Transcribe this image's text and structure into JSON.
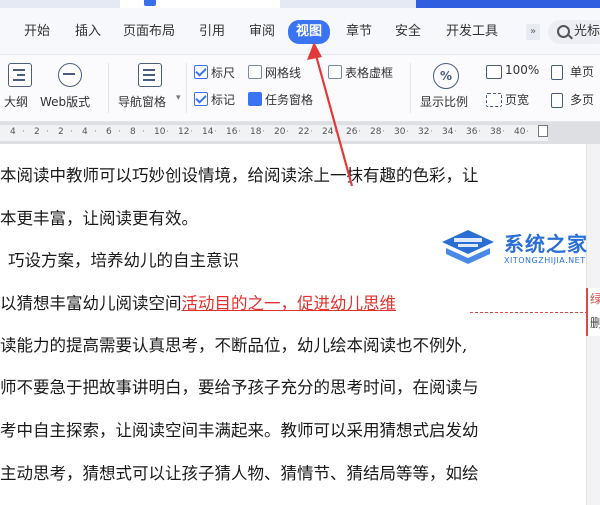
{
  "menu": {
    "tabs": [
      "开始",
      "插入",
      "页面布局",
      "引用",
      "审阅",
      "视图",
      "章节",
      "安全",
      "开发工具"
    ],
    "active_tab": "视图",
    "more": "»",
    "search_text": "光标"
  },
  "ribbon": {
    "outline_label": "大纲",
    "web_layout_label": "Web版式",
    "nav_pane_label": "导航窗格",
    "nav_pane_arrow": "▾",
    "checkboxes": {
      "ruler": {
        "label": "标尺",
        "checked": true
      },
      "gridlines": {
        "label": "网格线",
        "checked": false
      },
      "table_gridlines": {
        "label": "表格虚框",
        "checked": false
      },
      "marks": {
        "label": "标记",
        "checked": true
      },
      "task_pane": {
        "label": "任务窗格",
        "checked": true
      }
    },
    "zoom_label": "显示比例",
    "zoom_100": "100%",
    "page_width": "页宽",
    "single_page": "单页",
    "multi_page": "多页"
  },
  "ruler": {
    "numbers": [
      "4",
      "2",
      "2",
      "4",
      "6",
      "8",
      "10",
      "12",
      "14",
      "16",
      "18",
      "20",
      "22",
      "24",
      "26",
      "28",
      "30",
      "32",
      "34",
      "36",
      "38",
      "40"
    ]
  },
  "document": {
    "lines": [
      "本阅读中教师可以巧妙创设情境，给阅读涂上一抹有趣的色彩，让",
      "本更丰富，让阅读更有效。",
      "巧设方案，培养幼儿的自主意识",
      "以猜想丰富幼儿阅读空间",
      "读能力的提高需要认真思考，不断品位，幼儿绘本阅读也不例外,",
      "师不要急于把故事讲明白，要给予孩子充分的思考时间，在阅读与",
      "考中自主探索，让阅读空间丰满起来。教师可以采用猜想式启发幼",
      "主动思考，猜想式可以让孩子猜人物、猜情节、猜结局等等，如绘"
    ],
    "revised_text": "活动目的之一，促进幼儿思维",
    "comment_text_1": "绿",
    "comment_text_2": "删"
  },
  "watermark": {
    "title": "系统之家",
    "url": "XITONGZHIJIA.NET"
  },
  "colors": {
    "accent": "#3a74f2",
    "revision": "#e0332e",
    "arrow": "#e23a3a",
    "watermark": "#2a6fd6"
  }
}
